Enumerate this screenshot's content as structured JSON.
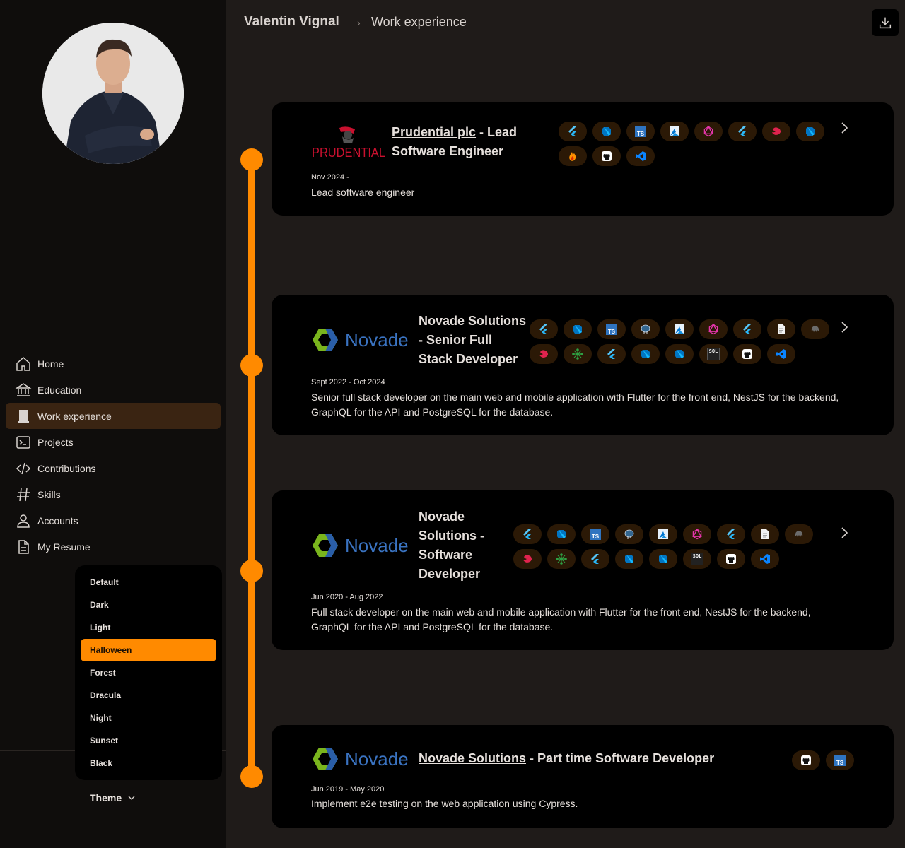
{
  "breadcrumb": {
    "name": "Valentin Vignal",
    "separator": "›",
    "page": "Work experience"
  },
  "nav": [
    {
      "label": "Home",
      "icon": "home-icon"
    },
    {
      "label": "Education",
      "icon": "bank-icon"
    },
    {
      "label": "Work experience",
      "icon": "building-icon",
      "active": true
    },
    {
      "label": "Projects",
      "icon": "terminal-icon"
    },
    {
      "label": "Contributions",
      "icon": "code-icon"
    },
    {
      "label": "Skills",
      "icon": "hash-icon"
    },
    {
      "label": "Accounts",
      "icon": "user-icon"
    },
    {
      "label": "My Resume",
      "icon": "document-icon"
    }
  ],
  "themes": [
    "Default",
    "Dark",
    "Light",
    "Halloween",
    "Forest",
    "Dracula",
    "Night",
    "Sunset",
    "Black"
  ],
  "selected_theme": "Halloween",
  "theme_button": "Theme",
  "colors": {
    "accent": "#ff8a00",
    "chip_bg": "#2b1906",
    "card_bg": "#000000",
    "page_bg": "#1f1b19",
    "sidebar_bg": "#0f0d0c"
  },
  "experiences": [
    {
      "logo": "PRUDENTIAL",
      "company": "Prudential plc",
      "role_lines": [
        "- Lead",
        "Software Engineer"
      ],
      "dates": "Nov 2024 -",
      "description": "Lead software engineer",
      "skills": [
        "flutter-icon",
        "dart-icon",
        "typescript-icon",
        "azure-icon",
        "graphql-icon",
        "flutter-icon",
        "nestjs-icon",
        "dart-icon",
        "firebase-icon",
        "github-icon",
        "vscode-icon"
      ]
    },
    {
      "logo": "Novade",
      "company": "Novade Solutions",
      "role_lines": [
        "- Senior Full",
        "Stack Developer"
      ],
      "dates": "Sept 2022 - Oct 2024",
      "description": "Senior full stack developer on the main web and mobile application with Flutter for the front end, NestJS for the backend, GraphQL for the API and PostgreSQL for the database.",
      "skills": [
        "flutter-icon",
        "dart-icon",
        "typescript-icon",
        "postgresql-icon",
        "azure-icon",
        "graphql-icon",
        "flutter-icon",
        "document-icon",
        "octopus-icon",
        "nestjs-icon",
        "network-icon",
        "flutter-icon",
        "dart-icon",
        "dart-icon",
        "sql-icon",
        "github-icon",
        "vscode-icon"
      ]
    },
    {
      "logo": "Novade",
      "company": "Novade",
      "company_line2": "Solutions",
      "role_lines": [
        "Software",
        "Developer"
      ],
      "dates": "Jun 2020 - Aug 2022",
      "description": "Full stack developer on the main web and mobile application with Flutter for the front end, NestJS for the backend, GraphQL for the API and PostgreSQL for the database.",
      "skills": [
        "flutter-icon",
        "dart-icon",
        "typescript-icon",
        "postgresql-icon",
        "azure-icon",
        "graphql-icon",
        "flutter-icon",
        "document-icon",
        "octopus-icon",
        "nestjs-icon",
        "network-icon",
        "flutter-icon",
        "dart-icon",
        "dart-icon",
        "sql-icon",
        "github-icon",
        "vscode-icon"
      ]
    },
    {
      "logo": "Novade",
      "company": "Novade Solutions",
      "role_lines": [
        "- Part time Software Developer"
      ],
      "dates": "Jun 2019 - May 2020",
      "description": "Implement e2e testing on the web application using Cypress.",
      "skills": [
        "github-icon",
        "typescript-icon"
      ]
    }
  ],
  "chip_text": {
    "ts": "TS",
    "sql": "SQL"
  }
}
